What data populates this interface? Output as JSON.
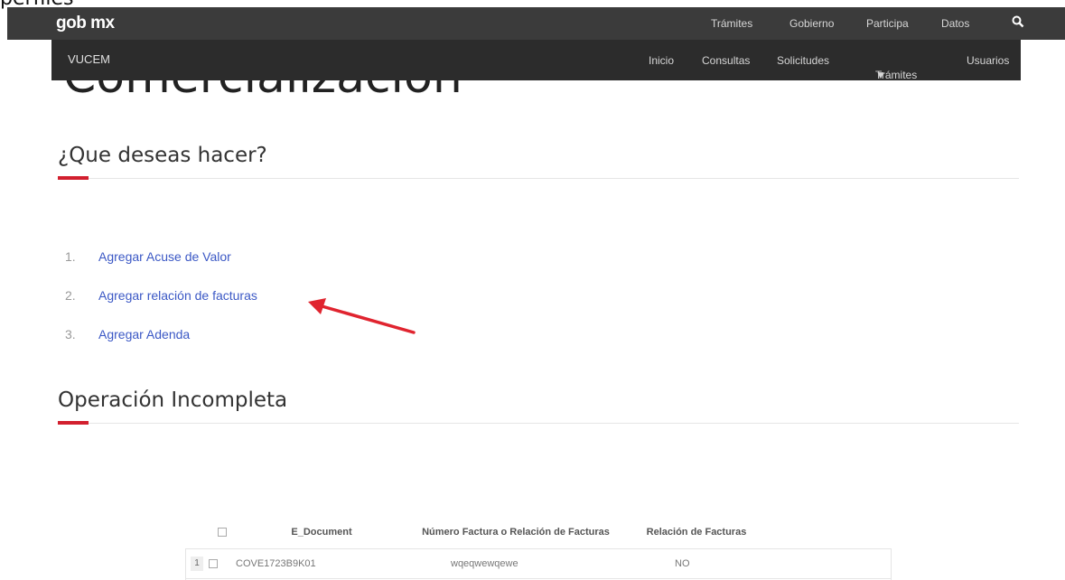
{
  "page_fragment": "perfiles",
  "header": {
    "logo": "gob mx",
    "nav": [
      "Trámites",
      "Gobierno",
      "Participa",
      "Datos"
    ]
  },
  "subheader": {
    "brand": "VUCEM",
    "nav": [
      "Inicio",
      "Consultas",
      "Solicitudes",
      "Trámites",
      "Usuarios"
    ]
  },
  "page_title": "Comercialización",
  "section1": {
    "title": "¿Que deseas hacer?",
    "options": [
      {
        "num": "1.",
        "label": "Agregar Acuse de Valor"
      },
      {
        "num": "2.",
        "label": "Agregar relación de facturas"
      },
      {
        "num": "3.",
        "label": "Agregar Adenda"
      }
    ]
  },
  "section2": {
    "title": "Operación Incompleta"
  },
  "table": {
    "headers": [
      "E_Document",
      "Número Factura o Relación de Facturas",
      "Relación de Facturas"
    ],
    "rows": [
      {
        "num": "1",
        "e_document": "COVE1723B9K01",
        "factura": "wqeqwewqewe",
        "relacion": "NO"
      }
    ]
  },
  "colors": {
    "topbar": "#3b3b3b",
    "subbar": "#2c2c2c",
    "accent": "#d21f2e",
    "link": "#3b58c5"
  }
}
